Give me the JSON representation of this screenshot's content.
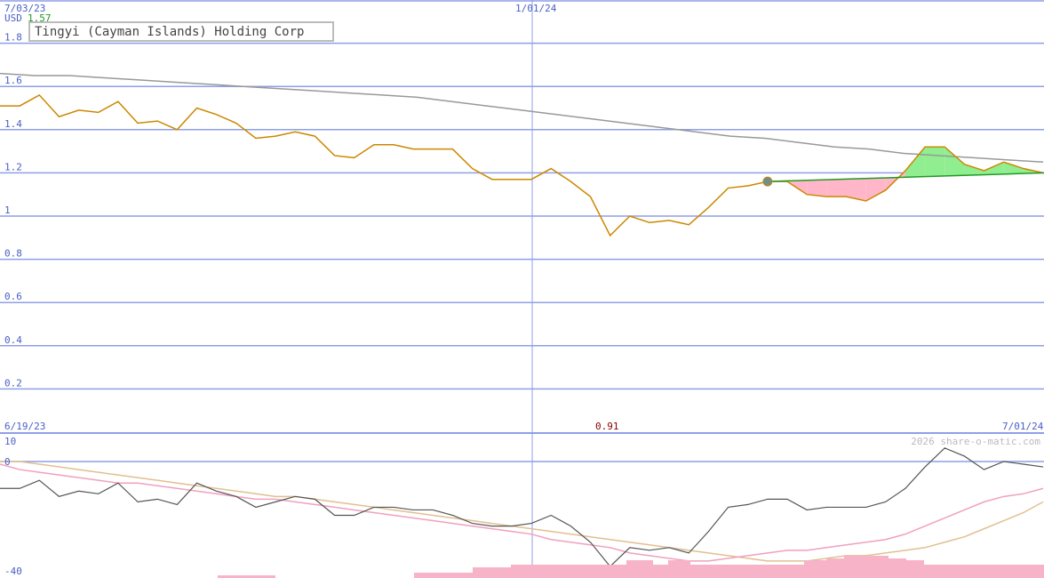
{
  "title": "Tingyi (Cayman Islands) Holding Corp",
  "currency": "USD",
  "last_price": "1.57",
  "low_label": "0.91",
  "watermark": "2026 share-o-matic.com",
  "top_dates": [
    "7/03/23",
    "1/01/24"
  ],
  "bottom_dates": [
    "6/19/23",
    "7/01/24"
  ],
  "colors": {
    "price": "#cc8800",
    "long_ma": "#999999",
    "trend": "#229922",
    "gain_fill": "#90ee90",
    "loss_fill": "#ffb6c8",
    "grid": "#8f9fe6",
    "axis_text": "#4a5ec8",
    "osc_main": "#555555",
    "osc_pink": "#f0a0c0",
    "osc_tan": "#e0c090",
    "volume": "#f7b3c8",
    "low_label": "#880000",
    "last_price": "#229922"
  },
  "chart_data": [
    {
      "type": "line",
      "title": "Tingyi (Cayman Islands) Holding Corp",
      "ylabel": "USD",
      "ylim": [
        0.12,
        1.96
      ],
      "yticks": [
        "0.2",
        "0.4",
        "0.6",
        "0.8",
        "1",
        "1.2",
        "1.4",
        "1.6",
        "1.8"
      ],
      "xticks": [
        "7/03/23",
        "1/01/24"
      ],
      "grid": true,
      "series": [
        {
          "role": "price",
          "values": [
            1.51,
            1.51,
            1.56,
            1.46,
            1.49,
            1.48,
            1.53,
            1.43,
            1.44,
            1.4,
            1.5,
            1.47,
            1.43,
            1.36,
            1.37,
            1.39,
            1.37,
            1.28,
            1.27,
            1.33,
            1.33,
            1.31,
            1.31,
            1.31,
            1.22,
            1.17,
            1.17,
            1.17,
            1.22,
            1.16,
            1.09,
            0.91,
            1.0,
            0.97,
            0.98,
            0.96,
            1.04,
            1.13,
            1.14,
            1.16,
            1.16,
            1.1,
            1.09,
            1.09,
            1.07,
            1.12,
            1.21,
            1.32,
            1.32,
            1.24,
            1.21,
            1.25,
            1.22,
            1.2
          ]
        },
        {
          "role": "long_ma",
          "values": [
            1.66,
            1.65,
            1.65,
            1.64,
            1.63,
            1.62,
            1.61,
            1.6,
            1.59,
            1.58,
            1.57,
            1.56,
            1.55,
            1.53,
            1.51,
            1.49,
            1.47,
            1.45,
            1.43,
            1.41,
            1.39,
            1.37,
            1.36,
            1.34,
            1.32,
            1.31,
            1.29,
            1.28,
            1.27,
            1.26,
            1.25
          ]
        },
        {
          "role": "trend",
          "values": [
            1.16,
            1.2
          ]
        }
      ]
    },
    {
      "type": "line",
      "ylim": [
        -40,
        10
      ],
      "yticks": [
        "10",
        "0",
        "-40"
      ],
      "xticks": [
        "6/19/23",
        "7/01/24"
      ],
      "series": [
        {
          "role": "oscillator",
          "values": [
            -10,
            -10,
            -7,
            -13,
            -11,
            -12,
            -8,
            -15,
            -14,
            -16,
            -8,
            -11,
            -13,
            -17,
            -15,
            -13,
            -14,
            -20,
            -20,
            -17,
            -17,
            -18,
            -18,
            -20,
            -23,
            -24,
            -24,
            -23,
            -20,
            -24,
            -30,
            -39,
            -32,
            -33,
            -32,
            -34,
            -26,
            -17,
            -16,
            -14,
            -14,
            -18,
            -17,
            -17,
            -17,
            -15,
            -10,
            -2,
            5,
            2,
            -3,
            0,
            -1,
            -2
          ]
        },
        {
          "role": "signal",
          "values": [
            -1,
            -3,
            -4,
            -5,
            -6,
            -7,
            -8,
            -8,
            -9,
            -10,
            -11,
            -12,
            -13,
            -14,
            -14,
            -15,
            -16,
            -17,
            -18,
            -19,
            -20,
            -21,
            -22,
            -23,
            -24,
            -25,
            -26,
            -27,
            -29,
            -30,
            -31,
            -32,
            -34,
            -35,
            -36,
            -37,
            -37,
            -36,
            -35,
            -34,
            -33,
            -33,
            -32,
            -31,
            -30,
            -29,
            -27,
            -24,
            -21,
            -18,
            -15,
            -13,
            -12,
            -10
          ]
        },
        {
          "role": "slow",
          "values": [
            0,
            0,
            -1,
            -2,
            -3,
            -4,
            -5,
            -6,
            -7,
            -8,
            -9,
            -10,
            -11,
            -12,
            -13,
            -13,
            -14,
            -15,
            -16,
            -17,
            -18,
            -19,
            -20,
            -21,
            -22,
            -23,
            -24,
            -25,
            -26,
            -27,
            -28,
            -29,
            -30,
            -31,
            -32,
            -33,
            -34,
            -35,
            -36,
            -37,
            -37,
            -37,
            -36,
            -35,
            -35,
            -34,
            -33,
            -32,
            -30,
            -28,
            -25,
            -22,
            -19,
            -15
          ]
        }
      ]
    }
  ]
}
